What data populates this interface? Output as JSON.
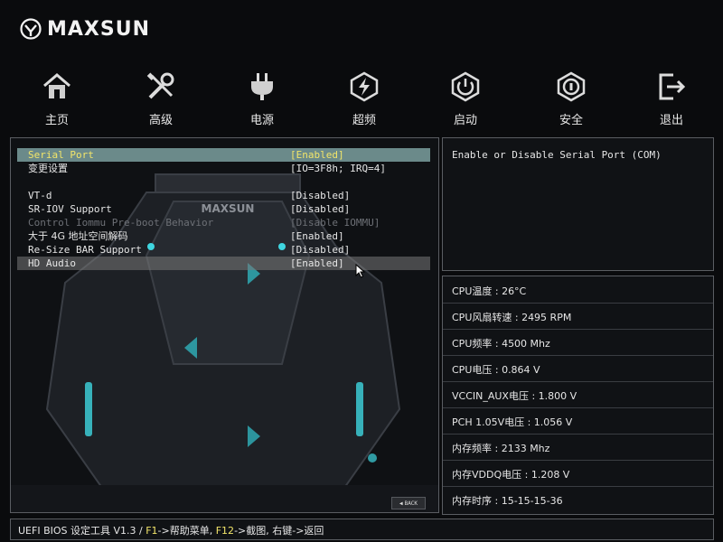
{
  "brand": {
    "name": "MAXSUN"
  },
  "nav": [
    {
      "label": "主页",
      "icon": "home-icon"
    },
    {
      "label": "高级",
      "icon": "tools-icon"
    },
    {
      "label": "电源",
      "icon": "power-plug-icon"
    },
    {
      "label": "超频",
      "icon": "lightning-icon"
    },
    {
      "label": "启动",
      "icon": "power-button-icon"
    },
    {
      "label": "安全",
      "icon": "shield-icon"
    },
    {
      "label": "退出",
      "icon": "exit-icon"
    }
  ],
  "menu": [
    {
      "label": "Serial Port",
      "value": "[Enabled]",
      "state": "selected"
    },
    {
      "label": "变更设置",
      "value": "[IO=3F8h; IRQ=4]",
      "state": "normal"
    },
    {
      "label": "",
      "value": "",
      "state": "spacer"
    },
    {
      "label": "VT-d",
      "value": "[Disabled]",
      "state": "normal"
    },
    {
      "label": "SR-IOV Support",
      "value": "[Disabled]",
      "state": "normal"
    },
    {
      "label": "Control Iommu Pre-boot Behavior",
      "value": "[Disable IOMMU]",
      "state": "disabled"
    },
    {
      "label": "大于 4G 地址空间解码",
      "value": "[Enabled]",
      "state": "normal"
    },
    {
      "label": "Re-Size BAR Support",
      "value": "[Disabled]",
      "state": "normal"
    },
    {
      "label": "HD Audio",
      "value": "[Enabled]",
      "state": "highlight"
    }
  ],
  "back_label": "BACK",
  "help_text": "Enable or Disable Serial Port (COM)",
  "status": [
    {
      "text": "CPU温度 : 26°C"
    },
    {
      "text": "CPU风扇转速 : 2495 RPM"
    },
    {
      "text": "CPU频率 : 4500 Mhz"
    },
    {
      "text": "CPU电压 : 0.864 V"
    },
    {
      "text": "VCCIN_AUX电压 : 1.800 V"
    },
    {
      "text": "PCH 1.05V电压 : 1.056 V"
    },
    {
      "text": "内存频率 : 2133 Mhz"
    },
    {
      "text": "内存VDDQ电压 : 1.208 V"
    },
    {
      "text": "内存时序 : 15-15-15-36"
    }
  ],
  "footer": {
    "prefix": "UEFI BIOS 设定工具 V1.3 / ",
    "f1_key": "F1",
    "f1_text": "->帮助菜单, ",
    "f12_key": "F12",
    "f12_text": "->截图, 右键->返回"
  },
  "colors": {
    "selected_bg": "#6b8a8a",
    "selected_text": "#f2e56a",
    "accent": "#2fc0c8"
  }
}
